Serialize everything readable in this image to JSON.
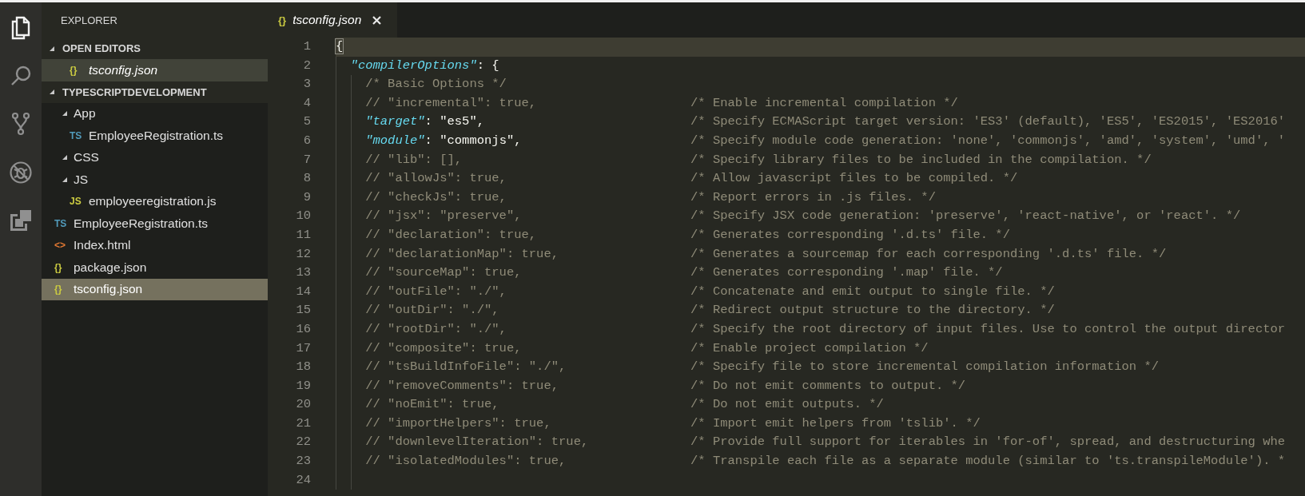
{
  "activity_bar": [
    {
      "kind": "files",
      "selected": true
    },
    {
      "kind": "search",
      "selected": false
    },
    {
      "kind": "source-control",
      "selected": false
    },
    {
      "kind": "debug",
      "selected": false
    },
    {
      "kind": "extensions",
      "selected": false
    }
  ],
  "sidebar": {
    "title": "EXPLORER",
    "sections": [
      {
        "title": "OPEN EDITORS",
        "expanded": true,
        "items": [
          {
            "kind": "json",
            "icon": "{}",
            "name": "tsconfig.json",
            "selected": true,
            "italic": true
          }
        ]
      },
      {
        "title": "TYPESCRIPTDEVELOPMENT",
        "expanded": true,
        "items": [
          {
            "kind": "folder",
            "name": "App",
            "expanded": true,
            "selected": false,
            "children": [
              {
                "kind": "ts",
                "icon": "TS",
                "name": "EmployeeRegistration.ts",
                "selected": false
              }
            ]
          },
          {
            "kind": "folder",
            "name": "CSS",
            "expanded": true,
            "selected": false
          },
          {
            "kind": "folder",
            "name": "JS",
            "expanded": true,
            "selected": false,
            "children": [
              {
                "kind": "js",
                "icon": "JS",
                "name": "employeeregistration.js",
                "selected": false
              }
            ]
          },
          {
            "kind": "ts",
            "icon": "TS",
            "name": "EmployeeRegistration.ts",
            "selected": false
          },
          {
            "kind": "html",
            "icon": "<>",
            "name": "Index.html",
            "selected": false
          },
          {
            "kind": "json",
            "icon": "{}",
            "name": "package.json",
            "selected": false
          },
          {
            "kind": "json",
            "icon": "{}",
            "name": "tsconfig.json",
            "selected": true
          }
        ]
      }
    ]
  },
  "tabs": [
    {
      "icon": "{}",
      "label": "tsconfig.json",
      "selected": true
    }
  ],
  "editor": {
    "lines": [
      {
        "number": "1",
        "current": true,
        "parts": [
          {
            "kind": "bracket",
            "text": "{"
          }
        ],
        "children": [
          {
            "number": "2",
            "current": false,
            "parts": [
              {
                "kind": "key",
                "text": "\"compilerOptions\""
              },
              {
                "kind": "punct",
                "text": ": {"
              }
            ],
            "children": [
              {
                "number": "3",
                "current": false,
                "parts": [
                  {
                    "kind": "comment",
                    "text": "/* Basic Options */"
                  }
                ]
              },
              {
                "number": "4",
                "current": false,
                "parts": [
                  {
                    "kind": "comment",
                    "text": "// \"incremental\": true,"
                  }
                ],
                "note": "/* Enable incremental compilation */"
              },
              {
                "number": "5",
                "current": false,
                "parts": [
                  {
                    "kind": "key",
                    "text": "\"target\""
                  },
                  {
                    "kind": "punct",
                    "text": ": "
                  },
                  {
                    "kind": "string",
                    "text": "\"es5\""
                  },
                  {
                    "kind": "punct",
                    "text": ","
                  }
                ],
                "note": "/* Specify ECMAScript target version: 'ES3' (default), 'ES5', 'ES2015', 'ES2016'"
              },
              {
                "number": "6",
                "current": false,
                "parts": [
                  {
                    "kind": "key",
                    "text": "\"module\""
                  },
                  {
                    "kind": "punct",
                    "text": ": "
                  },
                  {
                    "kind": "string",
                    "text": "\"commonjs\""
                  },
                  {
                    "kind": "punct",
                    "text": ","
                  }
                ],
                "note": "/* Specify module code generation: 'none', 'commonjs', 'amd', 'system', 'umd', '"
              },
              {
                "number": "7",
                "current": false,
                "parts": [
                  {
                    "kind": "comment",
                    "text": "// \"lib\": [],"
                  }
                ],
                "note": "/* Specify library files to be included in the compilation. */"
              },
              {
                "number": "8",
                "current": false,
                "parts": [
                  {
                    "kind": "comment",
                    "text": "// \"allowJs\": true,"
                  }
                ],
                "note": "/* Allow javascript files to be compiled. */"
              },
              {
                "number": "9",
                "current": false,
                "parts": [
                  {
                    "kind": "comment",
                    "text": "// \"checkJs\": true,"
                  }
                ],
                "note": "/* Report errors in .js files. */"
              },
              {
                "number": "10",
                "current": false,
                "parts": [
                  {
                    "kind": "comment",
                    "text": "// \"jsx\": \"preserve\","
                  }
                ],
                "note": "/* Specify JSX code generation: 'preserve', 'react-native', or 'react'. */"
              },
              {
                "number": "11",
                "current": false,
                "parts": [
                  {
                    "kind": "comment",
                    "text": "// \"declaration\": true,"
                  }
                ],
                "note": "/* Generates corresponding '.d.ts' file. */"
              },
              {
                "number": "12",
                "current": false,
                "parts": [
                  {
                    "kind": "comment",
                    "text": "// \"declarationMap\": true,"
                  }
                ],
                "note": "/* Generates a sourcemap for each corresponding '.d.ts' file. */"
              },
              {
                "number": "13",
                "current": false,
                "parts": [
                  {
                    "kind": "comment",
                    "text": "// \"sourceMap\": true,"
                  }
                ],
                "note": "/* Generates corresponding '.map' file. */"
              },
              {
                "number": "14",
                "current": false,
                "parts": [
                  {
                    "kind": "comment",
                    "text": "// \"outFile\": \"./\","
                  }
                ],
                "note": "/* Concatenate and emit output to single file. */"
              },
              {
                "number": "15",
                "current": false,
                "parts": [
                  {
                    "kind": "comment",
                    "text": "// \"outDir\": \"./\","
                  }
                ],
                "note": "/* Redirect output structure to the directory. */"
              },
              {
                "number": "16",
                "current": false,
                "parts": [
                  {
                    "kind": "comment",
                    "text": "// \"rootDir\": \"./\","
                  }
                ],
                "note": "/* Specify the root directory of input files. Use to control the output director"
              },
              {
                "number": "17",
                "current": false,
                "parts": [
                  {
                    "kind": "comment",
                    "text": "// \"composite\": true,"
                  }
                ],
                "note": "/* Enable project compilation */"
              },
              {
                "number": "18",
                "current": false,
                "parts": [
                  {
                    "kind": "comment",
                    "text": "// \"tsBuildInfoFile\": \"./\","
                  }
                ],
                "note": "/* Specify file to store incremental compilation information */"
              },
              {
                "number": "19",
                "current": false,
                "parts": [
                  {
                    "kind": "comment",
                    "text": "// \"removeComments\": true,"
                  }
                ],
                "note": "/* Do not emit comments to output. */"
              },
              {
                "number": "20",
                "current": false,
                "parts": [
                  {
                    "kind": "comment",
                    "text": "// \"noEmit\": true,"
                  }
                ],
                "note": "/* Do not emit outputs. */"
              },
              {
                "number": "21",
                "current": false,
                "parts": [
                  {
                    "kind": "comment",
                    "text": "// \"importHelpers\": true,"
                  }
                ],
                "note": "/* Import emit helpers from 'tslib'. */"
              },
              {
                "number": "22",
                "current": false,
                "parts": [
                  {
                    "kind": "comment",
                    "text": "// \"downlevelIteration\": true,"
                  }
                ],
                "note": "/* Provide full support for iterables in 'for-of', spread, and destructuring whe"
              },
              {
                "number": "23",
                "current": false,
                "parts": [
                  {
                    "kind": "comment",
                    "text": "// \"isolatedModules\": true,"
                  }
                ],
                "note": "/* Transpile each file as a separate module (similar to 'ts.transpileModule'). *"
              },
              {
                "number": "24",
                "current": false
              }
            ]
          }
        ]
      }
    ]
  }
}
